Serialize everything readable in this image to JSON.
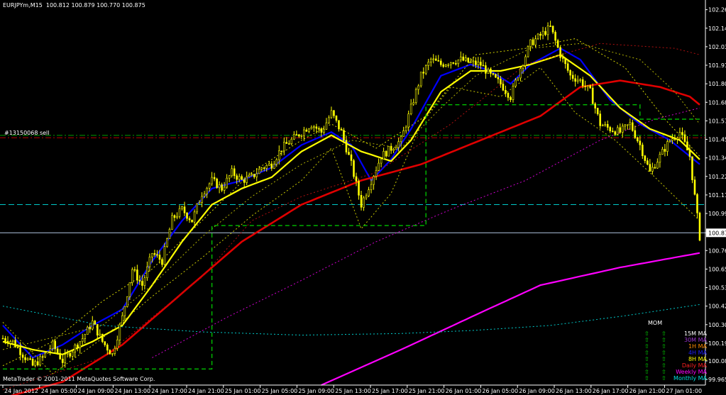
{
  "window": {
    "header": "EURJPYm,M15  100.812 100.879 100.770 100.875",
    "copyright": "MetaTrader © 2001-2011 MetaQuotes Software Corp.",
    "order_label": "#13150068 sell"
  },
  "chart_data": {
    "type": "candlestick",
    "symbol": "EURJPYm",
    "timeframe": "M15",
    "ohlc_header": {
      "open": 100.812,
      "high": 100.879,
      "low": 100.77,
      "close": 100.875
    },
    "ylim": [
      99.93,
      102.32
    ],
    "price_labels": [
      "102.260",
      "102.145",
      "102.030",
      "101.915",
      "101.800",
      "101.685",
      "101.570",
      "101.455",
      "101.340",
      "101.225",
      "101.110",
      "100.995",
      "100.875",
      "100.765",
      "100.650",
      "100.535",
      "100.420",
      "100.305",
      "100.190",
      "100.080",
      "99.965"
    ],
    "current_price": "100.875",
    "time_labels": [
      "24 Jan 2012",
      "24 Jan 05:00",
      "24 Jan 09:00",
      "24 Jan 13:00",
      "24 Jan 17:00",
      "24 Jan 21:00",
      "25 Jan 01:00",
      "25 Jan 05:00",
      "25 Jan 09:00",
      "25 Jan 13:00",
      "25 Jan 17:00",
      "25 Jan 21:00",
      "26 Jan 01:00",
      "26 Jan 05:00",
      "26 Jan 09:00",
      "26 Jan 13:00",
      "26 Jan 17:00",
      "26 Jan 21:00",
      "27 Jan 01:00"
    ],
    "price_anchors": [
      [
        0,
        100.22
      ],
      [
        4,
        100.2
      ],
      [
        8,
        100.12
      ],
      [
        12,
        100.05
      ],
      [
        16,
        100.1
      ],
      [
        20,
        100.18
      ],
      [
        24,
        100.08
      ],
      [
        28,
        100.15
      ],
      [
        32,
        100.22
      ],
      [
        36,
        100.32
      ],
      [
        40,
        100.2
      ],
      [
        44,
        100.12
      ],
      [
        48,
        100.35
      ],
      [
        52,
        100.65
      ],
      [
        56,
        100.55
      ],
      [
        60,
        100.75
      ],
      [
        64,
        100.7
      ],
      [
        68,
        100.96
      ],
      [
        72,
        101.02
      ],
      [
        76,
        100.95
      ],
      [
        80,
        101.12
      ],
      [
        84,
        101.2
      ],
      [
        88,
        101.15
      ],
      [
        92,
        101.25
      ],
      [
        96,
        101.2
      ],
      [
        100,
        101.22
      ],
      [
        104,
        101.28
      ],
      [
        108,
        101.3
      ],
      [
        112,
        101.4
      ],
      [
        116,
        101.45
      ],
      [
        120,
        101.5
      ],
      [
        124,
        101.55
      ],
      [
        128,
        101.5
      ],
      [
        132,
        101.62
      ],
      [
        136,
        101.5
      ],
      [
        140,
        101.3
      ],
      [
        144,
        101.05
      ],
      [
        148,
        101.2
      ],
      [
        152,
        101.35
      ],
      [
        156,
        101.4
      ],
      [
        160,
        101.45
      ],
      [
        164,
        101.65
      ],
      [
        168,
        101.85
      ],
      [
        172,
        101.95
      ],
      [
        176,
        101.92
      ],
      [
        180,
        101.94
      ],
      [
        184,
        101.95
      ],
      [
        188,
        101.93
      ],
      [
        192,
        101.92
      ],
      [
        196,
        101.85
      ],
      [
        200,
        101.8
      ],
      [
        204,
        101.72
      ],
      [
        208,
        101.9
      ],
      [
        212,
        102.05
      ],
      [
        216,
        102.1
      ],
      [
        220,
        102.15
      ],
      [
        224,
        101.98
      ],
      [
        228,
        101.85
      ],
      [
        232,
        101.82
      ],
      [
        236,
        101.75
      ],
      [
        240,
        101.55
      ],
      [
        244,
        101.52
      ],
      [
        248,
        101.5
      ],
      [
        252,
        101.55
      ],
      [
        256,
        101.42
      ],
      [
        260,
        101.25
      ],
      [
        264,
        101.35
      ],
      [
        268,
        101.45
      ],
      [
        272,
        101.5
      ],
      [
        276,
        101.35
      ],
      [
        280,
        100.85
      ]
    ],
    "overlays": [
      {
        "color": "#0000ff",
        "width": 2.2,
        "dash": "",
        "points": [
          [
            0,
            100.3
          ],
          [
            12,
            100.1
          ],
          [
            24,
            100.18
          ],
          [
            36,
            100.3
          ],
          [
            48,
            100.4
          ],
          [
            60,
            100.7
          ],
          [
            72,
            100.95
          ],
          [
            84,
            101.15
          ],
          [
            96,
            101.2
          ],
          [
            108,
            101.28
          ],
          [
            120,
            101.42
          ],
          [
            132,
            101.5
          ],
          [
            140,
            101.42
          ],
          [
            148,
            101.2
          ],
          [
            156,
            101.33
          ],
          [
            164,
            101.52
          ],
          [
            176,
            101.85
          ],
          [
            188,
            101.92
          ],
          [
            196,
            101.88
          ],
          [
            204,
            101.8
          ],
          [
            212,
            101.92
          ],
          [
            224,
            102.02
          ],
          [
            232,
            101.95
          ],
          [
            244,
            101.7
          ],
          [
            256,
            101.55
          ],
          [
            268,
            101.45
          ],
          [
            280,
            101.3
          ]
        ]
      },
      {
        "color": "#ffff00",
        "width": 2.2,
        "dash": "",
        "points": [
          [
            0,
            100.2
          ],
          [
            12,
            100.15
          ],
          [
            24,
            100.12
          ],
          [
            36,
            100.2
          ],
          [
            48,
            100.3
          ],
          [
            60,
            100.55
          ],
          [
            72,
            100.82
          ],
          [
            84,
            101.05
          ],
          [
            96,
            101.15
          ],
          [
            108,
            101.22
          ],
          [
            120,
            101.38
          ],
          [
            132,
            101.48
          ],
          [
            144,
            101.38
          ],
          [
            156,
            101.32
          ],
          [
            164,
            101.45
          ],
          [
            176,
            101.75
          ],
          [
            188,
            101.88
          ],
          [
            200,
            101.88
          ],
          [
            212,
            101.92
          ],
          [
            224,
            101.98
          ],
          [
            236,
            101.85
          ],
          [
            248,
            101.65
          ],
          [
            260,
            101.52
          ],
          [
            272,
            101.45
          ],
          [
            280,
            101.33
          ]
        ]
      },
      {
        "color": "#e00000",
        "width": 2.6,
        "dash": "",
        "points": [
          [
            0,
            99.85
          ],
          [
            24,
            99.95
          ],
          [
            48,
            100.18
          ],
          [
            72,
            100.5
          ],
          [
            96,
            100.82
          ],
          [
            120,
            101.05
          ],
          [
            144,
            101.2
          ],
          [
            168,
            101.3
          ],
          [
            192,
            101.45
          ],
          [
            216,
            101.6
          ],
          [
            232,
            101.78
          ],
          [
            248,
            101.82
          ],
          [
            264,
            101.78
          ],
          [
            276,
            101.72
          ],
          [
            280,
            101.67
          ]
        ]
      },
      {
        "color": "#ff00ff",
        "width": 2.2,
        "dash": "",
        "points": [
          [
            128,
            99.93
          ],
          [
            160,
            100.15
          ],
          [
            192,
            100.38
          ],
          [
            216,
            100.55
          ],
          [
            248,
            100.66
          ],
          [
            280,
            100.75
          ]
        ]
      },
      {
        "color": "#00c8c8",
        "width": 1,
        "dash": "2,3",
        "points": [
          [
            0,
            100.42
          ],
          [
            40,
            100.3
          ],
          [
            80,
            100.26
          ],
          [
            120,
            100.24
          ],
          [
            160,
            100.25
          ],
          [
            190,
            100.27
          ],
          [
            220,
            100.3
          ],
          [
            250,
            100.36
          ],
          [
            280,
            100.43
          ]
        ]
      },
      {
        "color": "#d000d0",
        "width": 1,
        "dash": "2,3",
        "points": [
          [
            60,
            100.1
          ],
          [
            90,
            100.35
          ],
          [
            120,
            100.58
          ],
          [
            150,
            100.82
          ],
          [
            180,
            101.02
          ],
          [
            210,
            101.2
          ],
          [
            240,
            101.45
          ],
          [
            262,
            101.58
          ],
          [
            280,
            101.65
          ]
        ]
      },
      {
        "color": "#b01010",
        "width": 1,
        "dash": "2,3",
        "points": [
          [
            0,
            99.9
          ],
          [
            40,
            100.1
          ],
          [
            80,
            100.6
          ],
          [
            100,
            100.95
          ],
          [
            120,
            101.1
          ],
          [
            150,
            101.25
          ],
          [
            180,
            101.55
          ],
          [
            210,
            101.92
          ],
          [
            240,
            102.05
          ],
          [
            270,
            102.02
          ],
          [
            280,
            101.98
          ]
        ]
      },
      {
        "color": "#b0b000",
        "width": 1,
        "dash": "2,3",
        "points": [
          [
            0,
            100.15
          ],
          [
            40,
            100.3
          ],
          [
            60,
            100.55
          ],
          [
            80,
            100.85
          ],
          [
            100,
            101.1
          ],
          [
            120,
            101.3
          ],
          [
            140,
            101.45
          ],
          [
            160,
            101.4
          ],
          [
            176,
            101.65
          ],
          [
            190,
            101.85
          ],
          [
            212,
            102.02
          ],
          [
            232,
            102.05
          ],
          [
            256,
            101.95
          ],
          [
            270,
            101.75
          ],
          [
            280,
            101.55
          ]
        ]
      },
      {
        "color": "#d8d800",
        "width": 1,
        "dash": "2,3",
        "points": [
          [
            0,
            100.05
          ],
          [
            20,
            100.2
          ],
          [
            40,
            100.45
          ],
          [
            60,
            100.65
          ],
          [
            80,
            100.95
          ],
          [
            100,
            101.25
          ],
          [
            120,
            101.45
          ],
          [
            132,
            101.55
          ],
          [
            150,
            101.4
          ],
          [
            170,
            101.6
          ],
          [
            190,
            101.98
          ],
          [
            210,
            102.02
          ],
          [
            230,
            102.08
          ],
          [
            250,
            101.9
          ],
          [
            266,
            101.58
          ],
          [
            280,
            101.35
          ]
        ]
      },
      {
        "color": "#c8c800",
        "width": 1,
        "dash": "2,3",
        "points": [
          [
            0,
            100.32
          ],
          [
            20,
            100.0
          ],
          [
            40,
            100.22
          ],
          [
            60,
            100.48
          ],
          [
            80,
            100.72
          ],
          [
            100,
            100.98
          ],
          [
            120,
            101.2
          ],
          [
            132,
            101.4
          ],
          [
            144,
            100.9
          ],
          [
            156,
            101.12
          ],
          [
            168,
            101.55
          ],
          [
            180,
            101.78
          ],
          [
            200,
            101.72
          ],
          [
            216,
            101.9
          ],
          [
            230,
            101.62
          ],
          [
            246,
            101.45
          ],
          [
            262,
            101.22
          ],
          [
            280,
            100.95
          ]
        ]
      }
    ],
    "box_line": {
      "color": "#00c000",
      "dash": "6,4",
      "points": [
        [
          0,
          100.03
        ],
        [
          84,
          100.03
        ],
        [
          84,
          100.92
        ],
        [
          170,
          100.92
        ],
        [
          170,
          101.67
        ],
        [
          256,
          101.67
        ],
        [
          256,
          101.58
        ],
        [
          280,
          101.58
        ]
      ]
    },
    "hlines": [
      {
        "price": 101.05,
        "color": "#00c8c8",
        "dash": "8,4",
        "width": 1
      },
      {
        "price": 101.48,
        "color": "#00a000",
        "dash": "8,3,2,3",
        "width": 1
      },
      {
        "price": 101.465,
        "color": "#b00000",
        "dash": "8,3,2,3",
        "width": 1
      },
      {
        "price": 100.875,
        "color": "#b0c4de",
        "dash": "",
        "width": 1
      }
    ],
    "mom_label": "MOM",
    "legend": [
      {
        "label": "15M MA",
        "color": "#ffffff"
      },
      {
        "label": "30M MA",
        "color": "#9932cc"
      },
      {
        "label": "1H MA",
        "color": "#ff8c00"
      },
      {
        "label": "4H MA",
        "color": "#1e1eff"
      },
      {
        "label": "8H MA",
        "color": "#ffff00"
      },
      {
        "label": "Daily MA",
        "color": "#ff2020"
      },
      {
        "label": "Weekly MA",
        "color": "#ff00ff"
      },
      {
        "label": "Monthly MA",
        "color": "#00e0e0"
      }
    ]
  }
}
